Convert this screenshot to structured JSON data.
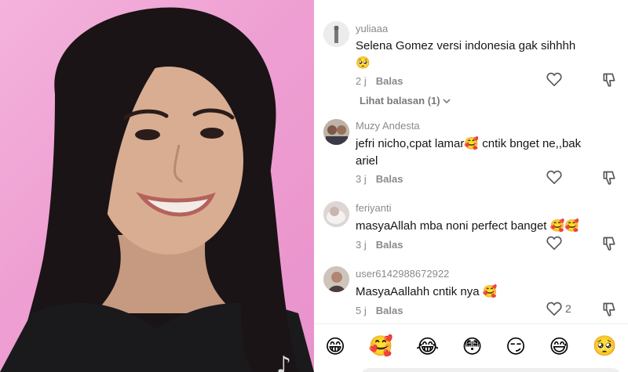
{
  "video": {
    "logo": "♪"
  },
  "comments": [
    {
      "username": "yuliaaa",
      "text": "Selena Gomez versi indonesia gak sihhhh 🥺",
      "time": "2 j",
      "reply_label": "Balas",
      "likes": "",
      "view_replies": "Lihat balasan (1)"
    },
    {
      "username": "Muzy Andesta",
      "text": "jefri nicho,cpat lamar🥰 cntik bnget ne,,bak ariel",
      "time": "3 j",
      "reply_label": "Balas",
      "likes": ""
    },
    {
      "username": "feriyanti",
      "text": "masyaAllah mba noni perfect banget 🥰🥰",
      "time": "3 j",
      "reply_label": "Balas",
      "likes": ""
    },
    {
      "username": "user6142988672922",
      "text": "MasyaAallahh cntik nya 🥰",
      "time": "5 j",
      "reply_label": "Balas",
      "likes": "2"
    }
  ],
  "emoji_bar": [
    "😁",
    "🥰",
    "😂",
    "😳",
    "😏",
    "😅",
    "🥺"
  ]
}
